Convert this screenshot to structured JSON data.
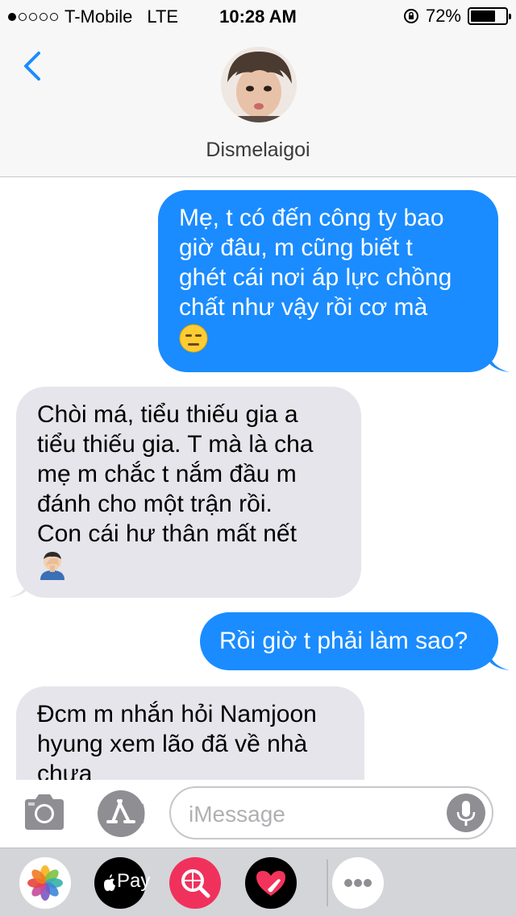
{
  "status_bar": {
    "carrier": "T-Mobile",
    "network": "LTE",
    "time": "10:28 AM",
    "battery": "72%",
    "battery_level": 0.72,
    "signal_bars": 1,
    "signal_total": 5
  },
  "header": {
    "back_icon": "chevron-left-icon",
    "contact_name": "Dismelaigoi"
  },
  "messages": [
    {
      "direction": "outgoing",
      "lines": [
        "Mẹ, t có đến công ty bao",
        "giờ đâu, m cũng biết t",
        "ghét cái nơi áp lực chồng",
        "chất như vậy rồi cơ mà"
      ],
      "emoji": "expressionless-face"
    },
    {
      "direction": "incoming",
      "lines": [
        "Chòi má, tiểu thiếu gia a",
        "tiểu thiếu gia. T mà là cha",
        "mẹ m chắc t nắm đầu m",
        "đánh cho một trận rồi.",
        "Con cái hư thân mất nết"
      ],
      "emoji": "man-facepalming"
    },
    {
      "direction": "outgoing",
      "lines": [
        "Rồi giờ t phải làm sao?"
      ]
    },
    {
      "direction": "incoming",
      "lines": [
        "Đcm m nhắn hỏi Namjoon",
        "hyung xem lão đã về nhà",
        "chưa"
      ]
    }
  ],
  "input": {
    "placeholder": "iMessage",
    "value": ""
  },
  "apps": {
    "apple_pay_label": "Pay",
    "items": [
      "photos-icon",
      "apple-pay-icon",
      "search-images-icon",
      "digital-touch-icon",
      "more-icon"
    ]
  },
  "colors": {
    "outgoing_bubble": "#1a8cff",
    "incoming_bubble": "#e6e5eb",
    "accent": "#1a8cff"
  }
}
